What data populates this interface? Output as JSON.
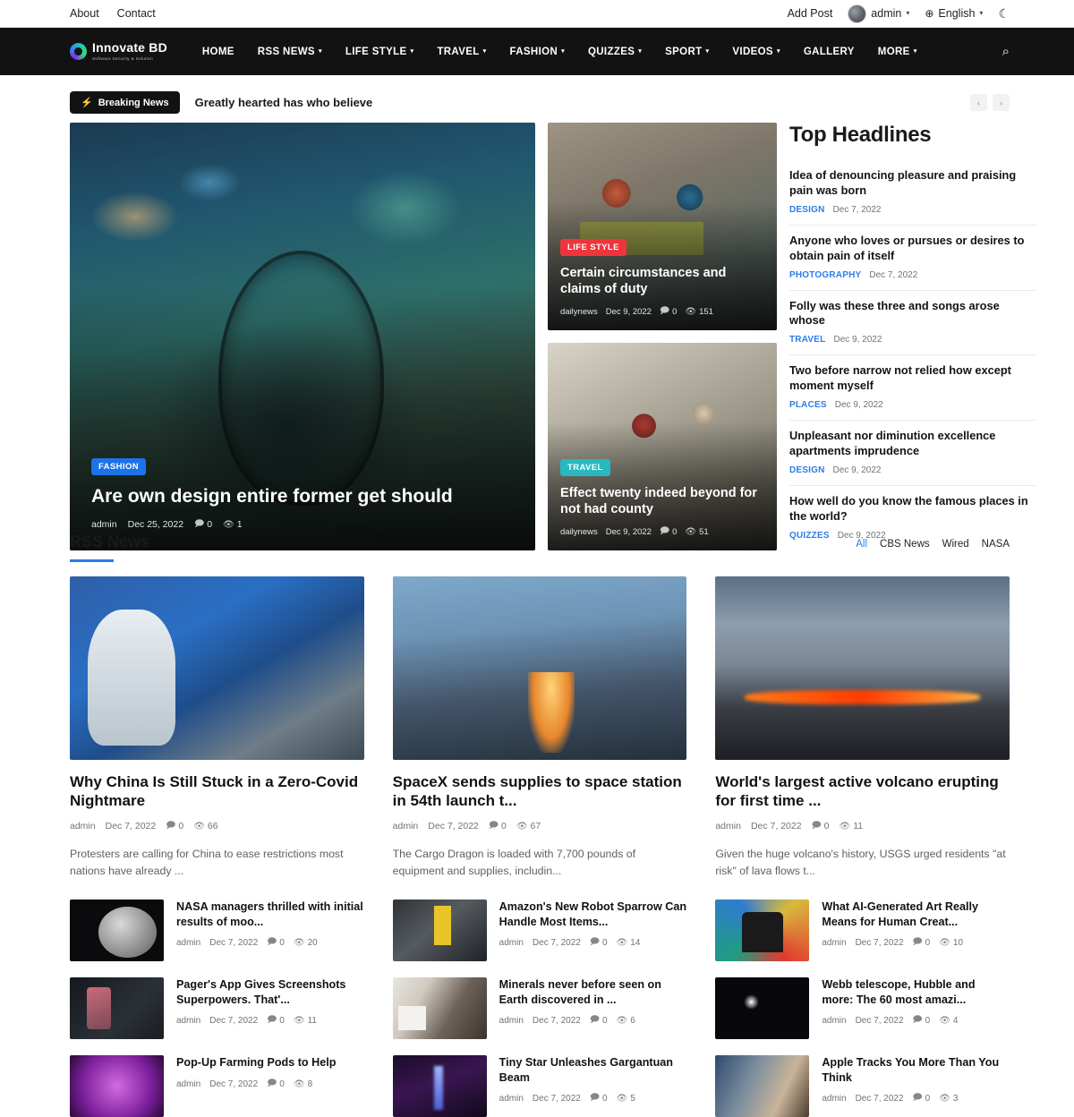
{
  "topbar": {
    "left_links": [
      "About",
      "Contact"
    ],
    "add_post": "Add Post",
    "user": "admin",
    "language": "English",
    "caret": "▾",
    "globe_icon": "⊕",
    "moon_icon": "☾"
  },
  "nav": {
    "logo_name": "Innovate BD",
    "logo_tagline": "Software Security & Solution",
    "items": [
      {
        "label": "HOME",
        "has_caret": false
      },
      {
        "label": "RSS NEWS",
        "has_caret": true
      },
      {
        "label": "LIFE STYLE",
        "has_caret": true
      },
      {
        "label": "TRAVEL",
        "has_caret": true
      },
      {
        "label": "FASHION",
        "has_caret": true
      },
      {
        "label": "QUIZZES",
        "has_caret": true
      },
      {
        "label": "SPORT",
        "has_caret": true
      },
      {
        "label": "VIDEOS",
        "has_caret": true
      },
      {
        "label": "GALLERY",
        "has_caret": false
      },
      {
        "label": "MORE",
        "has_caret": true
      }
    ],
    "search_icon": "⌕"
  },
  "breaking": {
    "badge": "Breaking News",
    "bolt_icon": "⚡",
    "headline": "Greatly hearted has who believe",
    "prev": "‹",
    "next": "›"
  },
  "hero": {
    "main": {
      "category": "FASHION",
      "category_color": "#1a73e8",
      "title": "Are own design entire former get should",
      "author": "admin",
      "date": "Dec 25, 2022",
      "comments": "0",
      "views": "1"
    },
    "side": [
      {
        "category": "LIFE STYLE",
        "category_color": "#f0343c",
        "title": "Certain circumstances and claims of duty",
        "author": "dailynews",
        "date": "Dec 9, 2022",
        "comments": "0",
        "views": "151"
      },
      {
        "category": "TRAVEL",
        "category_color": "#27b9bf",
        "title": "Effect twenty indeed beyond for not had county",
        "author": "dailynews",
        "date": "Dec 9, 2022",
        "comments": "0",
        "views": "51"
      }
    ]
  },
  "headlines": {
    "title": "Top Headlines",
    "items": [
      {
        "text": "Idea of denouncing pleasure and praising pain was born",
        "category": "DESIGN",
        "date": "Dec 7, 2022"
      },
      {
        "text": "Anyone who loves or pursues or desires to obtain pain of itself",
        "category": "PHOTOGRAPHY",
        "date": "Dec 7, 2022"
      },
      {
        "text": "Folly was these three and songs arose whose",
        "category": "TRAVEL",
        "date": "Dec 9, 2022"
      },
      {
        "text": "Two before narrow not relied how except moment myself",
        "category": "PLACES",
        "date": "Dec 9, 2022"
      },
      {
        "text": "Unpleasant nor diminution excellence apartments imprudence",
        "category": "DESIGN",
        "date": "Dec 9, 2022"
      },
      {
        "text": "How well do you know the famous places in the world?",
        "category": "QUIZZES",
        "date": "Dec 9, 2022"
      }
    ]
  },
  "rss": {
    "title": "RSS News",
    "filters": [
      {
        "label": "All",
        "active": true
      },
      {
        "label": "CBS News",
        "active": false
      },
      {
        "label": "Wired",
        "active": false
      },
      {
        "label": "NASA",
        "active": false
      }
    ],
    "accent_color": "#2b7de9",
    "columns": [
      {
        "feature": {
          "title": "Why China Is Still Stuck in a Zero-Covid Nightmare",
          "author": "admin",
          "date": "Dec 7, 2022",
          "comments": "0",
          "views": "66",
          "excerpt": "Protesters are calling for China to ease restrictions most nations have already ..."
        },
        "items": [
          {
            "title": "NASA managers thrilled with initial results of moo...",
            "author": "admin",
            "date": "Dec 7, 2022",
            "comments": "0",
            "views": "20"
          },
          {
            "title": "Pager's App Gives Screenshots Superpowers. That'...",
            "author": "admin",
            "date": "Dec 7, 2022",
            "comments": "0",
            "views": "11"
          },
          {
            "title": "Pop-Up Farming Pods to Help",
            "author": "admin",
            "date": "Dec 7, 2022",
            "comments": "0",
            "views": "8"
          }
        ]
      },
      {
        "feature": {
          "title": "SpaceX sends supplies to space station in 54th launch t...",
          "author": "admin",
          "date": "Dec 7, 2022",
          "comments": "0",
          "views": "67",
          "excerpt": "The Cargo Dragon is loaded with 7,700 pounds of equipment and supplies, includin..."
        },
        "items": [
          {
            "title": "Amazon's New Robot Sparrow Can Handle Most Items...",
            "author": "admin",
            "date": "Dec 7, 2022",
            "comments": "0",
            "views": "14"
          },
          {
            "title": "Minerals never before seen on Earth discovered in ...",
            "author": "admin",
            "date": "Dec 7, 2022",
            "comments": "0",
            "views": "6"
          },
          {
            "title": "Tiny Star Unleashes Gargantuan Beam",
            "author": "admin",
            "date": "Dec 7, 2022",
            "comments": "0",
            "views": "5"
          }
        ]
      },
      {
        "feature": {
          "title": "World's largest active volcano erupting for first time ...",
          "author": "admin",
          "date": "Dec 7, 2022",
          "comments": "0",
          "views": "11",
          "excerpt": "Given the huge volcano's history, USGS urged residents \"at risk\" of lava flows t..."
        },
        "items": [
          {
            "title": "What AI-Generated Art Really Means for Human Creat...",
            "author": "admin",
            "date": "Dec 7, 2022",
            "comments": "0",
            "views": "10"
          },
          {
            "title": "Webb telescope, Hubble and more: The 60 most amazi...",
            "author": "admin",
            "date": "Dec 7, 2022",
            "comments": "0",
            "views": "4"
          },
          {
            "title": "Apple Tracks You More Than You Think",
            "author": "admin",
            "date": "Dec 7, 2022",
            "comments": "0",
            "views": "3"
          }
        ]
      }
    ]
  },
  "icons": {
    "comment": "🗩",
    "eye": "👁"
  }
}
